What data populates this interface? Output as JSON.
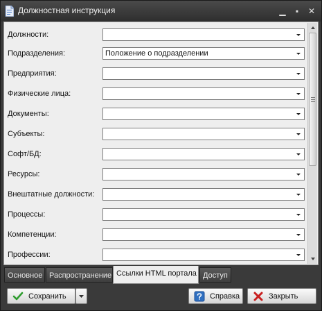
{
  "window": {
    "title": "Должностная инструкция",
    "minimize_glyph": "▁",
    "maximize_glyph": "▪",
    "close_glyph": "✕"
  },
  "form": {
    "rows": [
      {
        "label": "Должности:",
        "value": ""
      },
      {
        "label": "Подразделения:",
        "value": "Положение о подразделении"
      },
      {
        "label": "Предприятия:",
        "value": ""
      },
      {
        "label": "Физические лица:",
        "value": ""
      },
      {
        "label": "Документы:",
        "value": ""
      },
      {
        "label": "Субъекты:",
        "value": ""
      },
      {
        "label": "Софт/БД:",
        "value": ""
      },
      {
        "label": "Ресурсы:",
        "value": ""
      },
      {
        "label": "Внештатные должности:",
        "value": ""
      },
      {
        "label": "Процессы:",
        "value": ""
      },
      {
        "label": "Компетенции:",
        "value": ""
      },
      {
        "label": "Профессии:",
        "value": ""
      }
    ]
  },
  "tabs": [
    {
      "label": "Основное"
    },
    {
      "label": "Распространение"
    },
    {
      "label": "Ссылки HTML портала"
    },
    {
      "label": "Доступ"
    }
  ],
  "active_tab": "Ссылки HTML портала",
  "buttons": {
    "save": "Сохранить",
    "help": "Справка",
    "close": "Закрыть"
  },
  "icons": {
    "title": "document-icon",
    "save": "checkmark-icon",
    "help": "help-icon",
    "close": "red-x-icon"
  },
  "colors": {
    "window_bg": "#3a3a3a",
    "panel_bg": "#eeeeee",
    "save_check": "#2e9d2e",
    "help_blue": "#2f6fc0",
    "close_red": "#c81e1e"
  }
}
